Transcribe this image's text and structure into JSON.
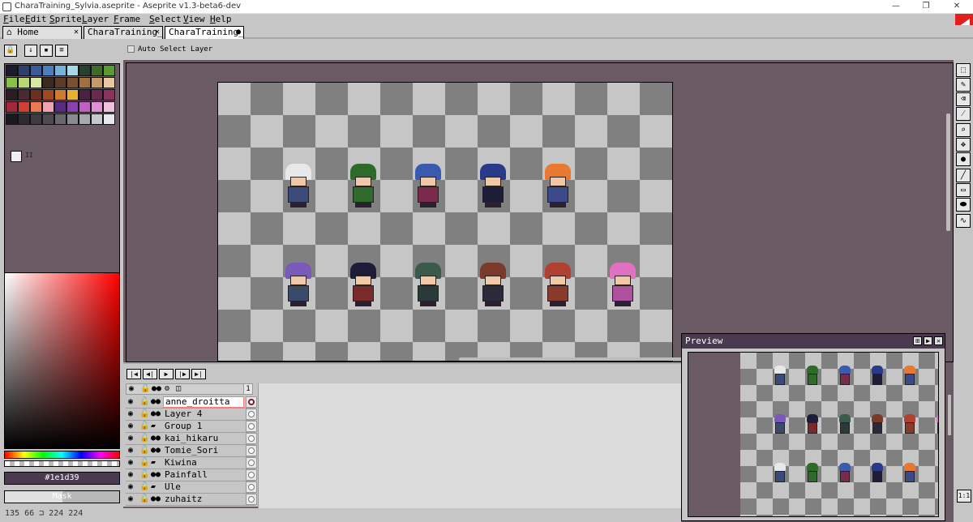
{
  "window": {
    "title": "CharaTraining_Sylvia.aseprite - Aseprite v1.3-beta6-dev",
    "minimize": "—",
    "maximize": "❐",
    "close": "✕"
  },
  "menu": [
    "File",
    "Edit",
    "Sprite",
    "Layer",
    "Frame",
    "Select",
    "View",
    "Help"
  ],
  "tabs": [
    {
      "label": "Home",
      "icon": "home-icon",
      "close": "✕"
    },
    {
      "label": "CharaTraining_",
      "close": "✕"
    },
    {
      "label": "CharaTraining_",
      "close": "●",
      "active": true
    }
  ],
  "palette": {
    "colors": [
      "#1a1c2c",
      "#2e3f6b",
      "#3d5a9a",
      "#4a7fbf",
      "#76b3d8",
      "#a5d8e8",
      "#28402c",
      "#3e6a2c",
      "#5c9a30",
      "#8ac048",
      "#b8d870",
      "#d8e8a0",
      "#3a2a20",
      "#5a3c28",
      "#7a5030",
      "#a07040",
      "#c89a68",
      "#e8c8a0",
      "#2a1e24",
      "#4a2a30",
      "#6a3020",
      "#a04820",
      "#d07a30",
      "#e8b030",
      "#4a2240",
      "#6a2a50",
      "#8a3260",
      "#a02838",
      "#d04030",
      "#e87a50",
      "#f0a0b0",
      "#5a2a80",
      "#8a40b0",
      "#c060c0",
      "#e090d8",
      "#f0c0e0",
      "#1a1a1e",
      "#2e2a30",
      "#3e3a40",
      "#4e4a50",
      "#6a6670",
      "#8a8890",
      "#a8a8b0",
      "#c8c8d0",
      "#e8e8f0"
    ],
    "fg_bg_label": "II",
    "mode_icons": [
      "lock-icon",
      "arrow-down-icon",
      "floppy-icon",
      "menu-icon"
    ]
  },
  "color_picker": {
    "hex": "#1e1d39",
    "mask_label": "Mask"
  },
  "contextbar": {
    "auto_select_label": "Auto Select Layer"
  },
  "toolbar": {
    "tools": [
      "marquee-icon",
      "pencil-icon",
      "eraser-icon",
      "eyedropper-icon",
      "zoom-icon",
      "move-icon",
      "paint-bucket-icon",
      "line-icon",
      "rectangle-icon",
      "ellipse-icon",
      "blur-icon"
    ]
  },
  "timeline": {
    "playback": [
      "first-frame-icon",
      "prev-frame-icon",
      "play-icon",
      "next-frame-icon",
      "last-frame-icon"
    ],
    "frame_number": "1",
    "layers": [
      {
        "name": "anne_droitta",
        "type": "layer",
        "active": true
      },
      {
        "name": "Layer 4",
        "type": "layer"
      },
      {
        "name": "Group 1",
        "type": "group"
      },
      {
        "name": "kai_hikaru",
        "type": "layer"
      },
      {
        "name": "Tomie_Sori",
        "type": "layer"
      },
      {
        "name": "Kiwina",
        "type": "group"
      },
      {
        "name": "Painfall",
        "type": "layer"
      },
      {
        "name": "Ule",
        "type": "group"
      },
      {
        "name": "zuhaitz",
        "type": "layer"
      }
    ]
  },
  "preview": {
    "title": "Preview",
    "zoom_label": "1:1"
  },
  "status": {
    "text": "135 66 ⊐ 224 224"
  },
  "sprites": {
    "row1": [
      {
        "hat": "#e8e8e8",
        "body": "#3a4a7a"
      },
      {
        "hat": "#2e6a2a",
        "body": "#2e6a2a"
      },
      {
        "hat": "#3a5ab0",
        "body": "#7a2a4a"
      },
      {
        "hat": "#2a3a8a",
        "body": "#1e1d39"
      },
      {
        "hat": "#e87a30",
        "body": "#3a4a8a"
      }
    ],
    "row2": [
      {
        "hat": "#7a5ab8",
        "body": "#3a4a6a"
      },
      {
        "hat": "#1e1d39",
        "body": "#7a2a2a"
      },
      {
        "hat": "#3a5a4a",
        "body": "#2a3a3a"
      },
      {
        "hat": "#7a3a2a",
        "body": "#2a2a3a"
      },
      {
        "hat": "#b04030",
        "body": "#8a3a2a"
      },
      {
        "hat": "#e070c0",
        "body": "#b050a0"
      }
    ]
  }
}
